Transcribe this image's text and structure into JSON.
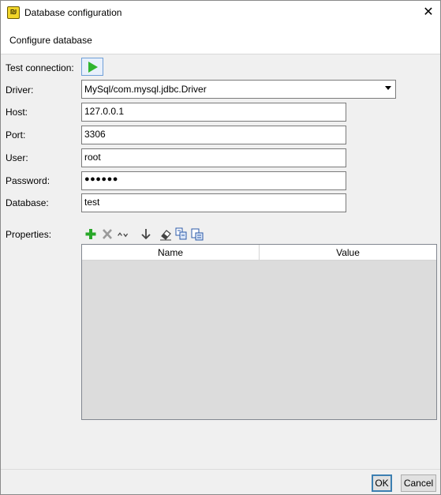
{
  "window": {
    "title": "Database configuration",
    "close_glyph": "✕",
    "icon": "database-config-icon"
  },
  "header": {
    "text": "Configure database"
  },
  "form": {
    "test_connection_label": "Test connection:",
    "driver_label": "Driver:",
    "driver_value": "MySql/com.mysql.jdbc.Driver",
    "host_label": "Host:",
    "host_value": "127.0.0.1",
    "port_label": "Port:",
    "port_value": "3306",
    "user_label": "User:",
    "user_value": "root",
    "password_label": "Password:",
    "password_mask": "●●●●●●",
    "database_label": "Database:",
    "database_value": "test",
    "properties_label": "Properties:"
  },
  "properties_toolbar": {
    "icons": [
      "add-icon",
      "delete-icon",
      "move-up-icon",
      "move-down-icon",
      "eraser-icon",
      "copy-icon",
      "paste-icon"
    ]
  },
  "properties_table": {
    "columns": [
      "Name",
      "Value"
    ],
    "rows": []
  },
  "buttons": {
    "ok": "OK",
    "cancel": "Cancel"
  },
  "colors": {
    "play_green": "#2fb52f",
    "add_green": "#2aa82a",
    "header_bg": "#ffffff",
    "panel_bg": "#f0f0f0"
  }
}
